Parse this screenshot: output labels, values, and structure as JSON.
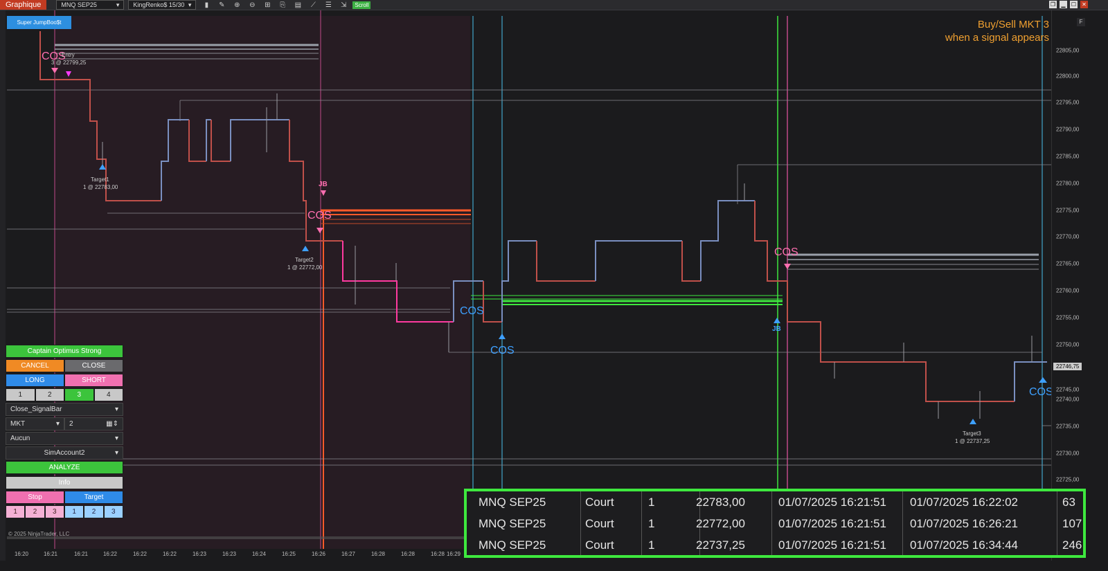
{
  "toolbar": {
    "app_tab": "Graphique",
    "instrument": "MNQ SEP25",
    "bar_type": "KingRenko$ 15/30",
    "scroll_label": "Scroll",
    "tools": [
      "bar-chart-icon",
      "draw-pencil-icon",
      "zoom-in-icon",
      "zoom-out-icon",
      "crosshair-icon",
      "strategy-icon",
      "data-box-icon",
      "line-tools-icon",
      "properties-icon",
      "scroll-lock-icon"
    ],
    "window_buttons": [
      "❐",
      "▁",
      "☐",
      "✕"
    ]
  },
  "indicator_badge": "Super JumpBoo$t",
  "annotation": {
    "line1": "Buy/Sell MKT 3",
    "line2": "when a signal appears"
  },
  "chart_labels": {
    "entry": "Entry",
    "entry_fill": "3 @ 22799,25",
    "target1": "Target1",
    "target1_fill": "1 @ 22783,00",
    "target2": "Target2",
    "target2_fill": "1 @ 22772,00",
    "target3": "Target3",
    "target3_fill": "1 @ 22737,25",
    "cos": "COS",
    "jb": "JB"
  },
  "panel": {
    "title": "Captain Optimus Strong",
    "cancel": "CANCEL",
    "close": "CLOSE",
    "long": "LONG",
    "short": "SHORT",
    "qty_buttons": [
      "1",
      "2",
      "3",
      "4"
    ],
    "close_mode": "Close_SignalBar",
    "order_type": "MKT",
    "order_qty": "2",
    "atm": "Aucun",
    "account": "SimAccount2",
    "analyze": "ANALYZE",
    "info": "Info",
    "stop": "Stop",
    "target": "Target",
    "stop_levels": [
      "1",
      "2",
      "3"
    ],
    "target_levels": [
      "1",
      "2",
      "3"
    ]
  },
  "copyright": "© 2025 NinjaTrader, LLC",
  "time_axis": [
    "16:20",
    "16:21",
    "16:21",
    "16:22",
    "16:22",
    "16:22",
    "16:23",
    "16:23",
    "16:24",
    "16:25",
    "16:26",
    "16:27",
    "16:28",
    "16:28",
    "16:28",
    "16:29"
  ],
  "price_axis": [
    "22805,00",
    "22800,00",
    "22795,00",
    "22790,00",
    "22785,00",
    "22780,00",
    "22775,00",
    "22770,00",
    "22765,00",
    "22760,00",
    "22755,00",
    "22750,00",
    "22745,00",
    "22740,00",
    "22735,00",
    "22730,00",
    "22725,00"
  ],
  "current_price": "22746,75",
  "f_button": "F",
  "trades": [
    {
      "instrument": "MNQ SEP25",
      "side": "Court",
      "qty": "1",
      "price": "22783,00",
      "entry_time": "01/07/2025 16:21:51",
      "exit_time": "01/07/2025 16:22:02",
      "bars": "63"
    },
    {
      "instrument": "MNQ SEP25",
      "side": "Court",
      "qty": "1",
      "price": "22772,00",
      "entry_time": "01/07/2025 16:21:51",
      "exit_time": "01/07/2025 16:26:21",
      "bars": "107"
    },
    {
      "instrument": "MNQ SEP25",
      "side": "Court",
      "qty": "1",
      "price": "22737,25",
      "entry_time": "01/07/2025 16:21:51",
      "exit_time": "01/07/2025 16:34:44",
      "bars": "246"
    }
  ],
  "colors": {
    "bull": "#7a8fc0",
    "bear": "#c0504a",
    "pink_run": "#ff3aa0",
    "cos_pink": "#ff6fb0",
    "cos_blue": "#3ea0ff",
    "signal_green": "#3ee83e",
    "resistance_red": "#ff5a2a",
    "annotation": "#f0a030"
  }
}
